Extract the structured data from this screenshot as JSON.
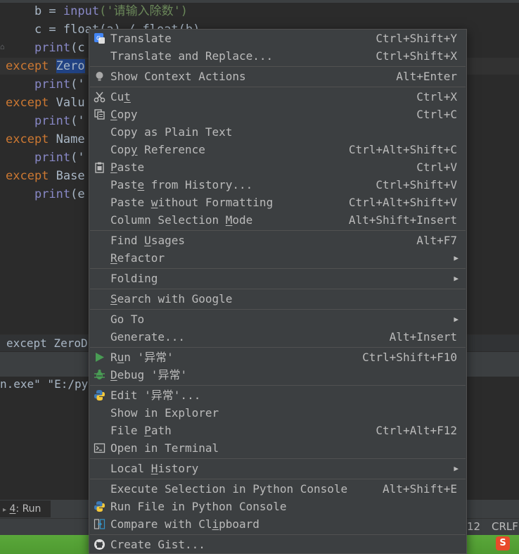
{
  "editor": {
    "lines": [
      {
        "indent": "    ",
        "text": "b = ",
        "fn": "input",
        "str": "('请输入除数')"
      },
      {
        "indent": "    ",
        "text": "c = float(a) / float(b)"
      },
      {
        "indent": "    ",
        "fn": "print",
        "text": "(c"
      },
      {
        "kw": "except",
        "sel": "Zero"
      },
      {
        "indent": "    ",
        "fn": "print",
        "text": "('"
      },
      {
        "kw": "except",
        "text": "Valu"
      },
      {
        "indent": "    ",
        "fn": "print",
        "text": "('"
      },
      {
        "kw": "except",
        "text": "Name"
      },
      {
        "indent": "    ",
        "fn": "print",
        "text": "('"
      },
      {
        "kw": "except",
        "text": "Base"
      },
      {
        "indent": "    ",
        "fn": "print",
        "text": "(e"
      }
    ]
  },
  "breadcrumb": {
    "text": "except ZeroD"
  },
  "console": {
    "text": "n.exe\" \"E:/py"
  },
  "run_tab": {
    "number": "4",
    "label": ": Run"
  },
  "status": {
    "line_col": "12",
    "line_sep": "CRLF"
  },
  "ime": {
    "label": "S"
  },
  "context_menu": {
    "items": [
      {
        "id": "translate",
        "pre": "Translate",
        "ul": "",
        "post": "",
        "shortcut": "Ctrl+Shift+Y",
        "icon": "google-translate-icon"
      },
      {
        "id": "translate-replace",
        "pre": "Translate and Replace...",
        "ul": "",
        "post": "",
        "shortcut": "Ctrl+Shift+X"
      },
      {
        "id": "show-context-actions",
        "pre": "Show Context Actions",
        "ul": "",
        "post": "",
        "shortcut": "Alt+Enter",
        "icon": "lightbulb-icon"
      },
      {
        "id": "cut",
        "pre": "Cu",
        "ul": "t",
        "post": "",
        "shortcut": "Ctrl+X",
        "icon": "scissors-icon"
      },
      {
        "id": "copy",
        "pre": "",
        "ul": "C",
        "post": "opy",
        "shortcut": "Ctrl+C",
        "icon": "copy-icon"
      },
      {
        "id": "copy-plain",
        "pre": "Copy as Plain Text",
        "ul": "",
        "post": "",
        "shortcut": ""
      },
      {
        "id": "copy-reference",
        "pre": "Cop",
        "ul": "y",
        "post": " Reference",
        "shortcut": "Ctrl+Alt+Shift+C"
      },
      {
        "id": "paste",
        "pre": "",
        "ul": "P",
        "post": "aste",
        "shortcut": "Ctrl+V",
        "icon": "clipboard-icon"
      },
      {
        "id": "paste-history",
        "pre": "Past",
        "ul": "e",
        "post": " from History...",
        "shortcut": "Ctrl+Shift+V"
      },
      {
        "id": "paste-no-format",
        "pre": "Paste ",
        "ul": "w",
        "post": "ithout Formatting",
        "shortcut": "Ctrl+Alt+Shift+V"
      },
      {
        "id": "column-selection",
        "pre": "Column Selection ",
        "ul": "M",
        "post": "ode",
        "shortcut": "Alt+Shift+Insert"
      },
      {
        "id": "find-usages",
        "pre": "Find ",
        "ul": "U",
        "post": "sages",
        "shortcut": "Alt+F7"
      },
      {
        "id": "refactor",
        "pre": "",
        "ul": "R",
        "post": "efactor",
        "shortcut": "",
        "submenu": true
      },
      {
        "id": "folding",
        "pre": "Folding",
        "ul": "",
        "post": "",
        "shortcut": "",
        "submenu": true
      },
      {
        "id": "search-google",
        "pre": "",
        "ul": "S",
        "post": "earch with Google",
        "shortcut": ""
      },
      {
        "id": "go-to",
        "pre": "Go To",
        "ul": "",
        "post": "",
        "shortcut": "",
        "submenu": true
      },
      {
        "id": "generate",
        "pre": "Generate...",
        "ul": "",
        "post": "",
        "shortcut": "Alt+Insert"
      },
      {
        "id": "run",
        "pre": "R",
        "ul": "u",
        "post": "n '异常'",
        "shortcut": "Ctrl+Shift+F10",
        "icon": "run-icon"
      },
      {
        "id": "debug",
        "pre": "",
        "ul": "D",
        "post": "ebug '异常'",
        "shortcut": "",
        "icon": "bug-icon"
      },
      {
        "id": "edit-config",
        "pre": "Edit '异常'...",
        "ul": "",
        "post": "",
        "shortcut": "",
        "icon": "python-icon"
      },
      {
        "id": "show-explorer",
        "pre": "Show in Explorer",
        "ul": "",
        "post": "",
        "shortcut": ""
      },
      {
        "id": "file-path",
        "pre": "File ",
        "ul": "P",
        "post": "ath",
        "shortcut": "Ctrl+Alt+F12"
      },
      {
        "id": "open-terminal",
        "pre": "Open in Terminal",
        "ul": "",
        "post": "",
        "shortcut": "",
        "icon": "terminal-icon"
      },
      {
        "id": "local-history",
        "pre": "Local ",
        "ul": "H",
        "post": "istory",
        "shortcut": "",
        "submenu": true
      },
      {
        "id": "execute-selection",
        "pre": "Execute Selection in Python Console",
        "ul": "",
        "post": "",
        "shortcut": "Alt+Shift+E"
      },
      {
        "id": "run-file-console",
        "pre": "Run File in Python Console",
        "ul": "",
        "post": "",
        "shortcut": "",
        "icon": "python-icon"
      },
      {
        "id": "compare-clipboard",
        "pre": "Compare with Cl",
        "ul": "i",
        "post": "pboard",
        "shortcut": "",
        "icon": "compare-icon"
      },
      {
        "id": "create-gist",
        "pre": "Create Gist...",
        "ul": "",
        "post": "",
        "shortcut": "",
        "icon": "github-icon"
      }
    ]
  }
}
